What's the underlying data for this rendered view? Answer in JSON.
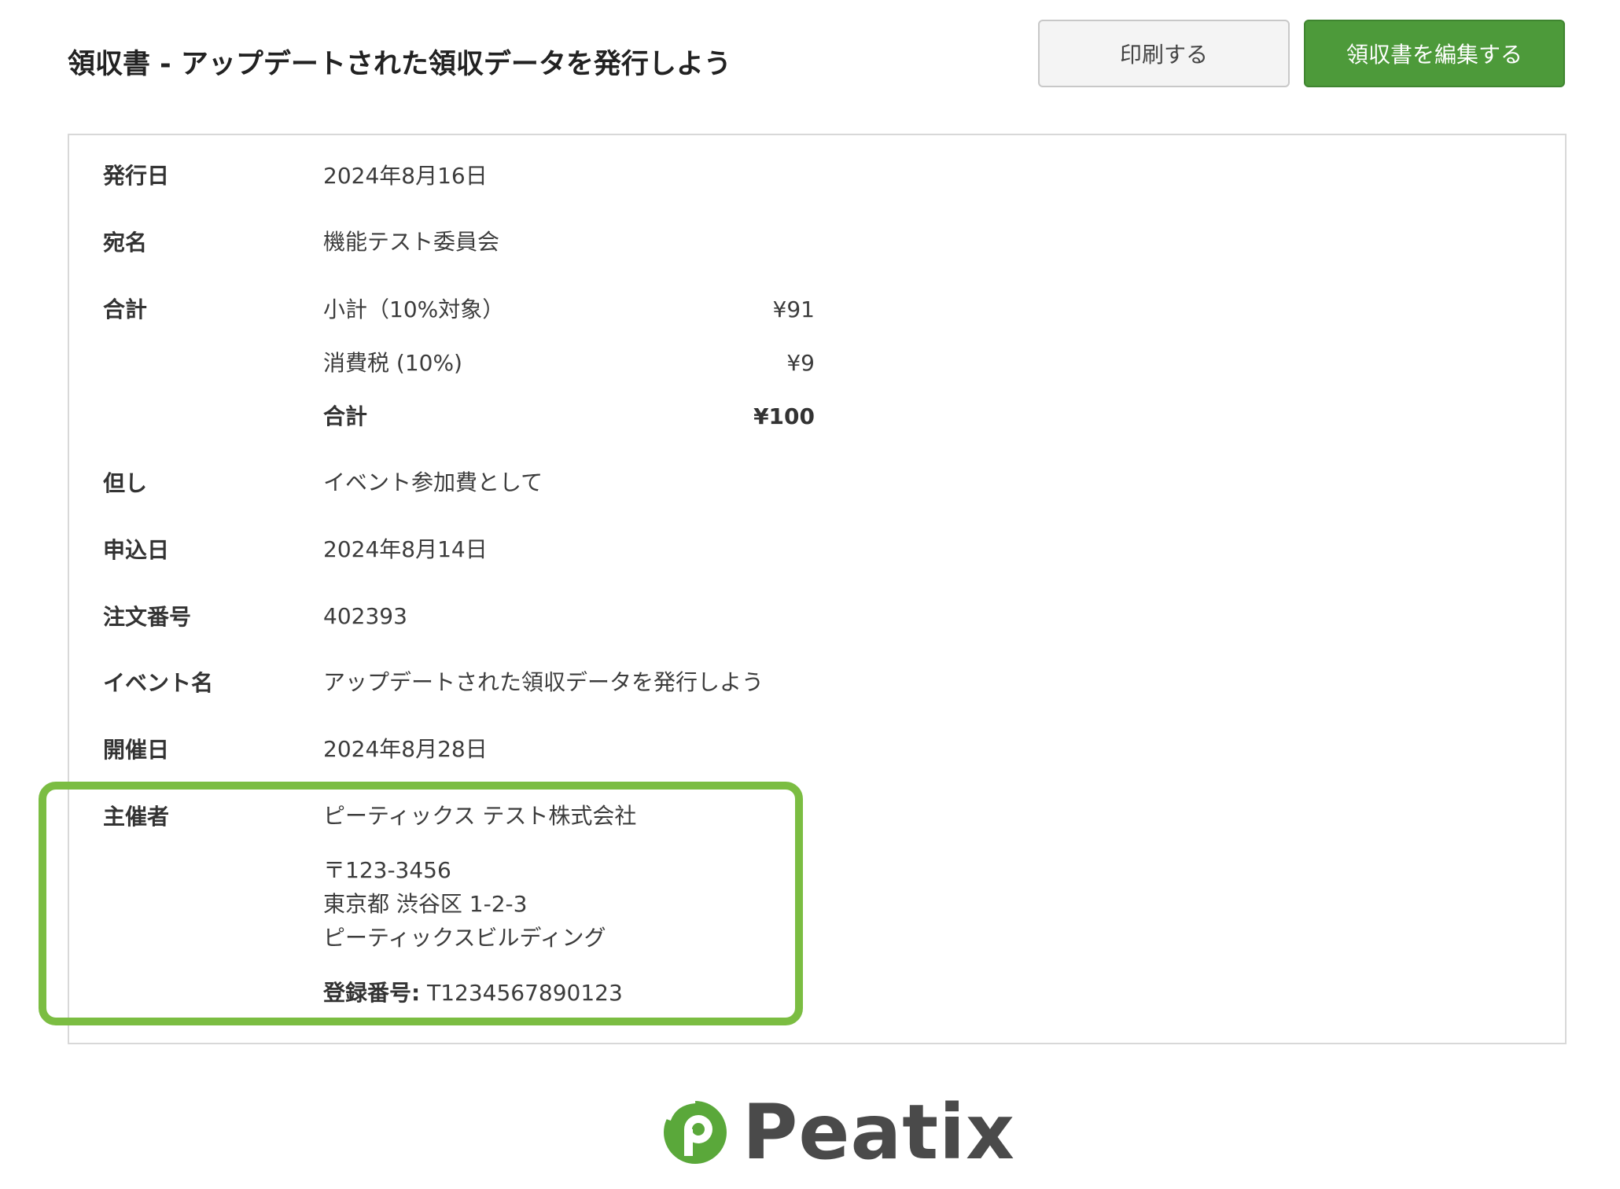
{
  "header": {
    "title": "領収書 - アップデートされた領収データを発行しよう",
    "print_label": "印刷する",
    "edit_label": "領収書を編集する"
  },
  "receipt": {
    "issue_date": {
      "label": "発行日",
      "value": "2024年8月16日"
    },
    "recipient": {
      "label": "宛名",
      "value": "機能テスト委員会"
    },
    "total": {
      "label": "合計",
      "subtotal_label": "小計（10%対象）",
      "subtotal_value": "¥91",
      "tax_label": "消費税 (10%)",
      "tax_value": "¥9",
      "total_label": "合計",
      "total_value": "¥100"
    },
    "note": {
      "label": "但し",
      "value": "イベント参加費として"
    },
    "application_date": {
      "label": "申込日",
      "value": "2024年8月14日"
    },
    "order_number": {
      "label": "注文番号",
      "value": "402393"
    },
    "event_name": {
      "label": "イベント名",
      "value": "アップデートされた領収データを発行しよう"
    },
    "event_date": {
      "label": "開催日",
      "value": "2024年8月28日"
    },
    "organizer": {
      "label": "主催者",
      "name": "ピーティックス テスト株式会社",
      "postal": "〒123-3456",
      "address_line1": "東京都 渋谷区 1-2-3",
      "address_line2": "ピーティックスビルディング",
      "registration_label": "登録番号:",
      "registration_number": "T1234567890123"
    }
  },
  "footer": {
    "logo_text": "Peatix",
    "logo_icon": "peatix-logo-icon",
    "logo_color": "#5aa83a"
  },
  "colors": {
    "accent": "#4d9a3a",
    "highlight": "#7bbd42"
  }
}
